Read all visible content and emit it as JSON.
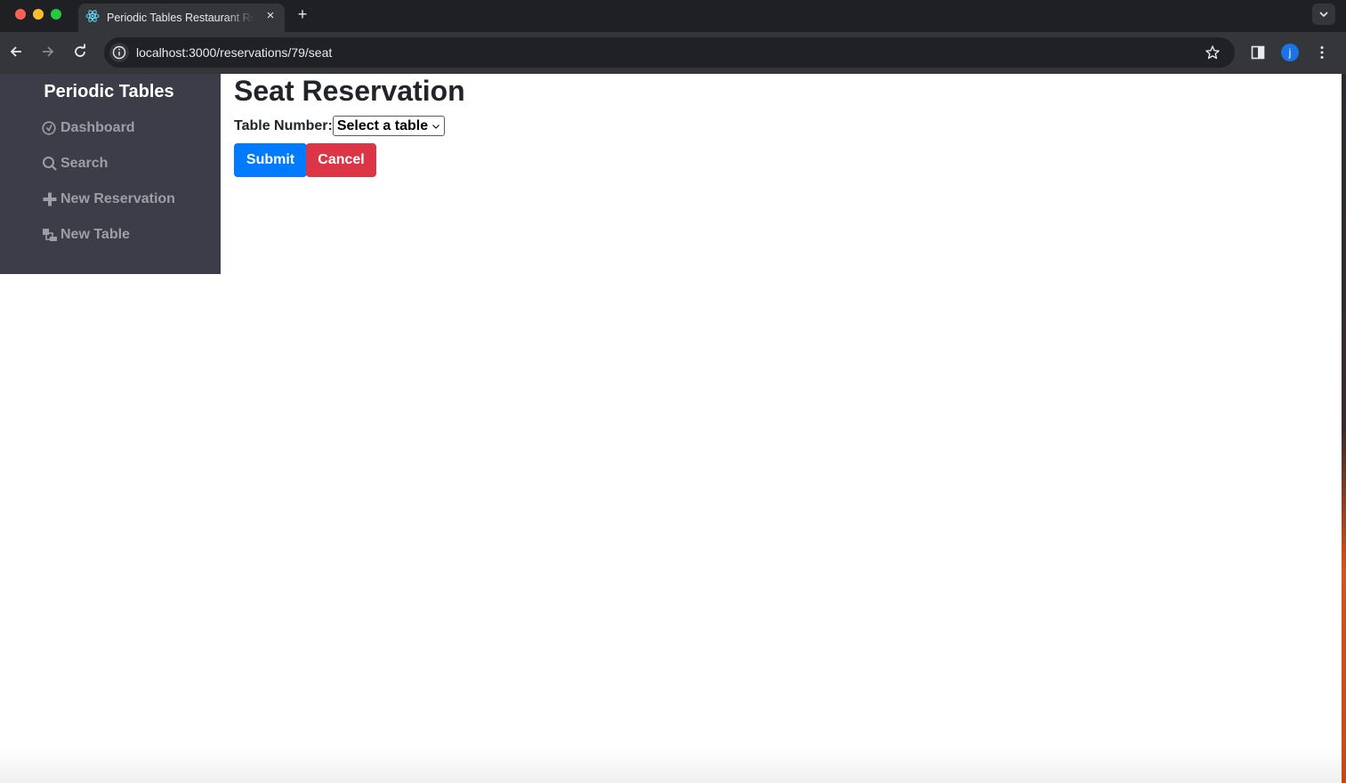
{
  "browser": {
    "tab_title": "Periodic Tables Restaurant Reservations",
    "url": "localhost:3000/reservations/79/seat",
    "profile_initial": "j",
    "tab_close_glyph": "×",
    "new_tab_glyph": "+"
  },
  "sidebar": {
    "brand": "Periodic Tables",
    "items": [
      {
        "label": "Dashboard",
        "icon": "dashboard-icon"
      },
      {
        "label": "Search",
        "icon": "search-icon"
      },
      {
        "label": "New Reservation",
        "icon": "plus-icon"
      },
      {
        "label": "New Table",
        "icon": "layers-icon"
      }
    ]
  },
  "main": {
    "title": "Seat Reservation",
    "table_label": "Table Number:",
    "table_select_value": "Select a table",
    "submit_label": "Submit",
    "cancel_label": "Cancel"
  },
  "colors": {
    "sidebar_bg": "#3c3d48",
    "submit": "#007bff",
    "cancel": "#dc3545"
  }
}
